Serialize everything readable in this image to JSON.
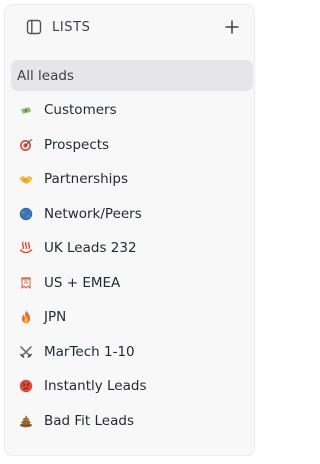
{
  "header": {
    "title": "LISTS",
    "icon": "sidebar-toggle-icon",
    "add_icon": "plus-icon"
  },
  "lists": {
    "items": [
      {
        "label": "All leads",
        "icon": "",
        "active": true
      },
      {
        "label": "Customers",
        "icon": "money-wings-icon",
        "active": false
      },
      {
        "label": "Prospects",
        "icon": "target-icon",
        "active": false
      },
      {
        "label": "Partnerships",
        "icon": "handshake-icon",
        "active": false
      },
      {
        "label": "Network/Peers",
        "icon": "globe-icon",
        "active": false
      },
      {
        "label": "UK Leads 232",
        "icon": "hot-springs-icon",
        "active": false
      },
      {
        "label": "US + EMEA",
        "icon": "banner-icon",
        "active": false
      },
      {
        "label": "JPN",
        "icon": "fire-icon",
        "active": false
      },
      {
        "label": "MarTech 1-10",
        "icon": "crossed-swords-icon",
        "active": false
      },
      {
        "label": "Instantly Leads",
        "icon": "angry-face-icon",
        "active": false
      },
      {
        "label": "Bad Fit Leads",
        "icon": "poop-icon",
        "active": false
      }
    ]
  }
}
